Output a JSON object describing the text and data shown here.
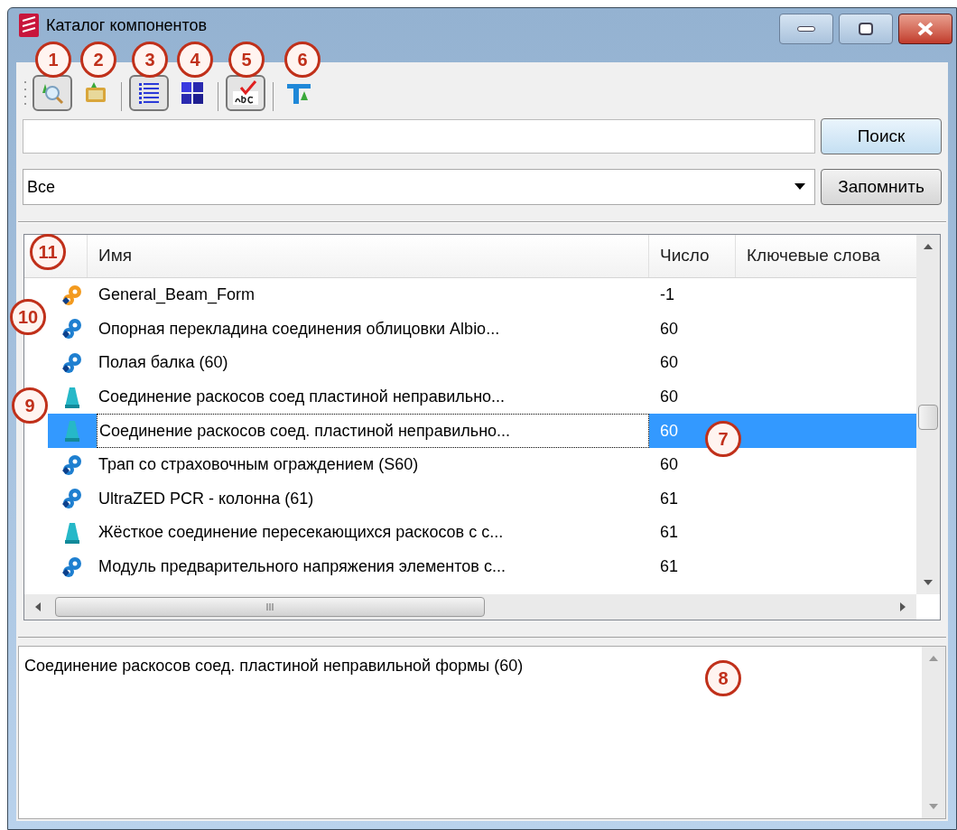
{
  "window": {
    "title": "Каталог компонентов"
  },
  "toolbar": [
    {
      "kind": "find",
      "selected": true
    },
    {
      "kind": "folder",
      "selected": false
    },
    {
      "kind": "list",
      "selected": true
    },
    {
      "kind": "tiles",
      "selected": false
    },
    {
      "kind": "spell",
      "selected": true
    },
    {
      "kind": "filter",
      "selected": false
    }
  ],
  "search": {
    "button": "Поиск"
  },
  "filter": {
    "value": "Все",
    "button": "Запомнить"
  },
  "table": {
    "columns": [
      "Имя",
      "Число",
      "Ключевые слова"
    ],
    "rows": [
      {
        "kind": "sketch",
        "name": "General_Beam_Form",
        "count": "-1",
        "selected": false
      },
      {
        "kind": "plugin",
        "name": "Опорная перекладина соединения облицовки Albio...",
        "count": "60",
        "selected": false
      },
      {
        "kind": "plugin",
        "name": "Полая балка (60)",
        "count": "60",
        "selected": false
      },
      {
        "kind": "detail",
        "name": "Соединение раскосов соед пластиной неправильно...",
        "count": "60",
        "selected": false
      },
      {
        "kind": "detail",
        "name": "Соединение раскосов соед. пластиной неправильно...",
        "count": "60",
        "selected": true
      },
      {
        "kind": "plugin",
        "name": "Трап со страховочным ограждением (S60)",
        "count": "60",
        "selected": false
      },
      {
        "kind": "plugin",
        "name": "UltraZED PCR - колонна (61)",
        "count": "61",
        "selected": false
      },
      {
        "kind": "detail",
        "name": "Жёсткое соединение пересекающихся раскосов с с...",
        "count": "61",
        "selected": false
      },
      {
        "kind": "plugin",
        "name": "Модуль предварительного напряжения элементов с...",
        "count": "61",
        "selected": false
      }
    ]
  },
  "description": "Соединение раскосов соед. пластиной неправильной формы (60)",
  "callouts": [
    "1",
    "2",
    "3",
    "4",
    "5",
    "6",
    "7",
    "8",
    "9",
    "10",
    "11"
  ]
}
